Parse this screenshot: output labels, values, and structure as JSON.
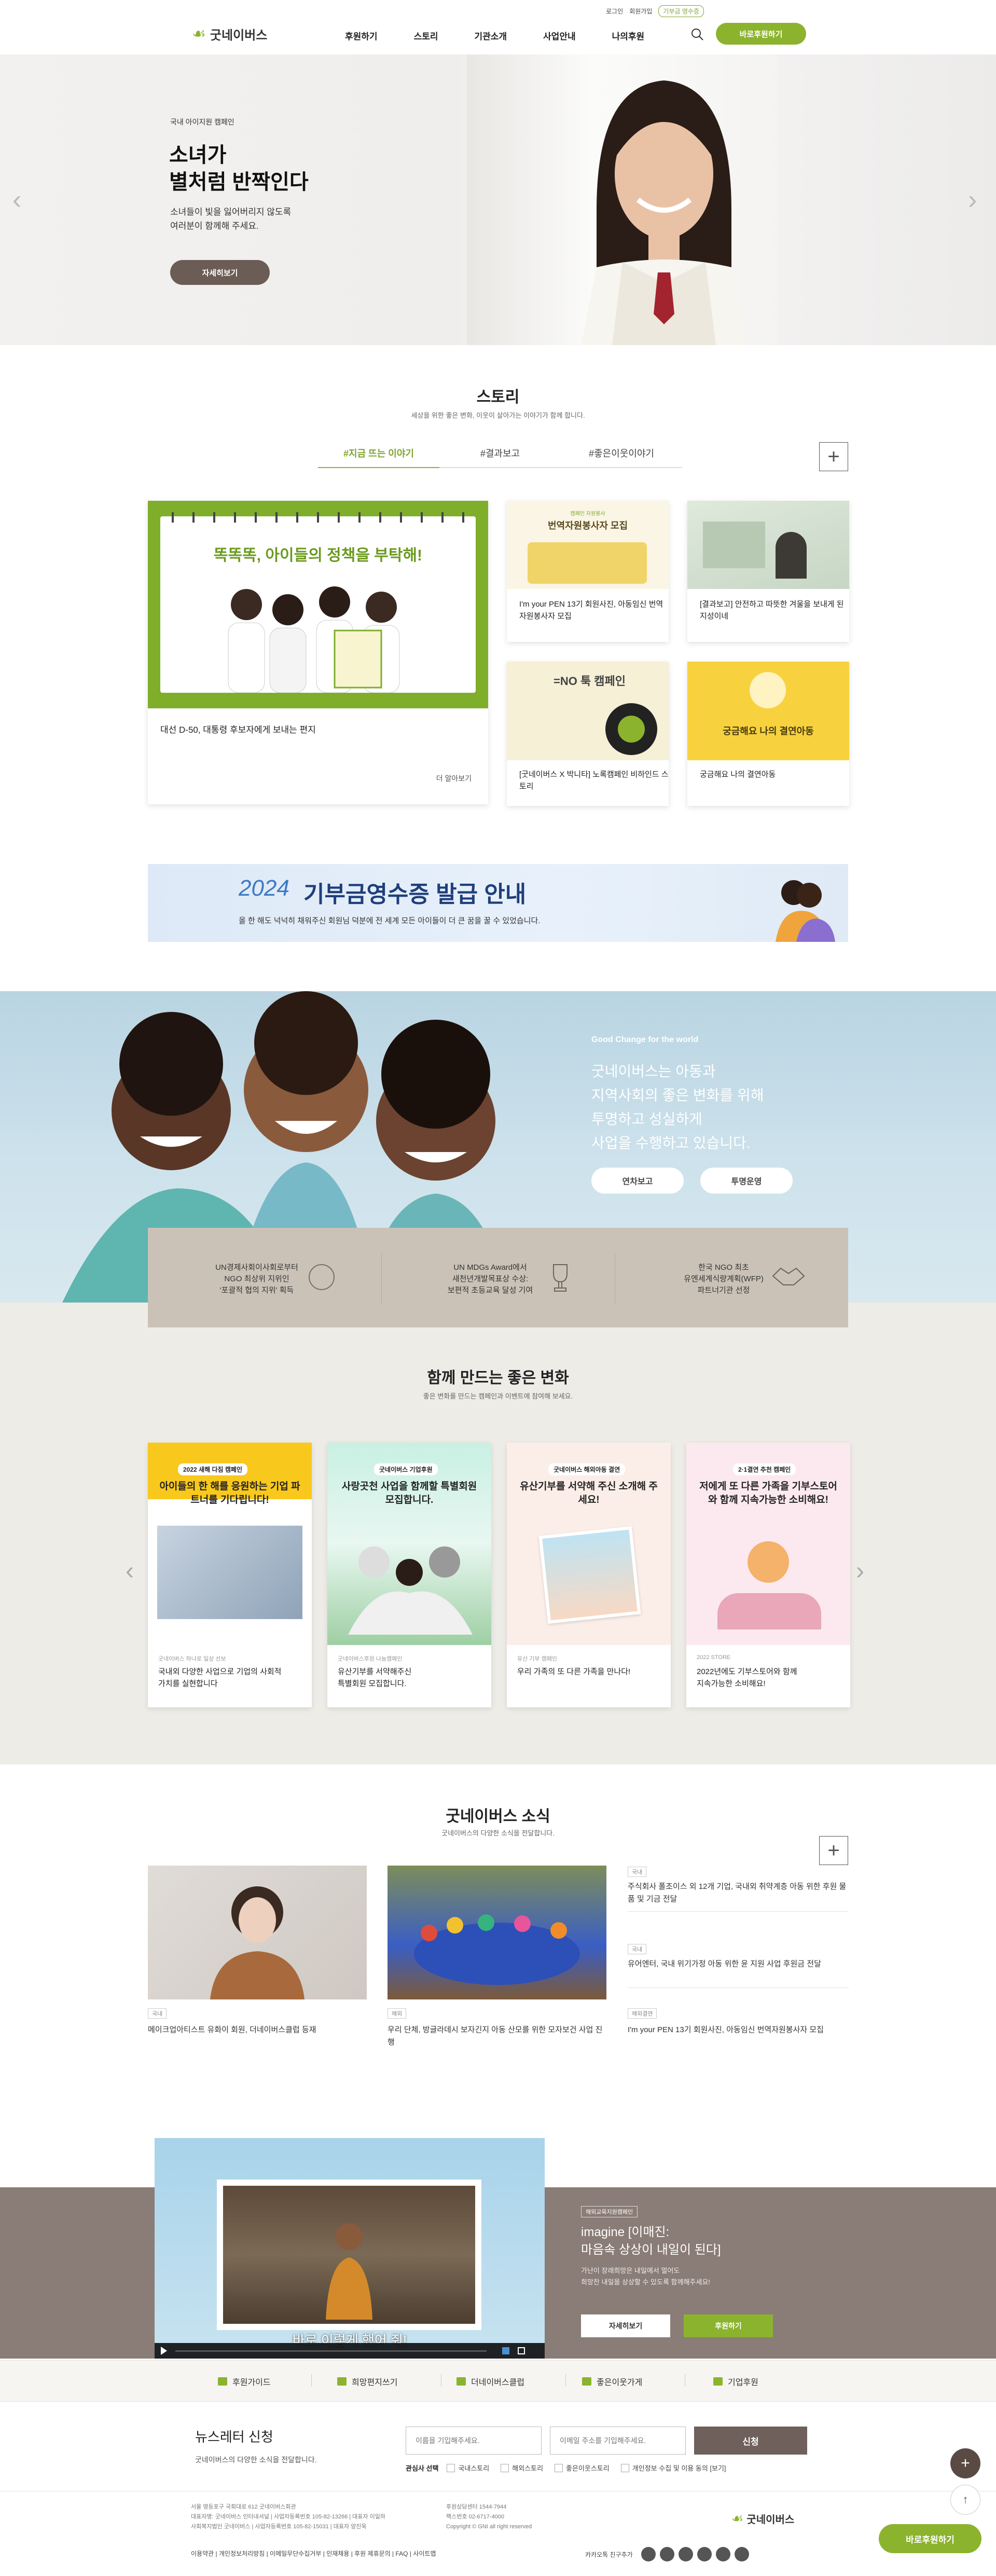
{
  "util": {
    "login": "로그인",
    "join": "회원가입",
    "pill": "기부금 영수증"
  },
  "header": {
    "logo": "굿네이버스",
    "nav": [
      "후원하기",
      "스토리",
      "기관소개",
      "사업안내",
      "나의후원"
    ],
    "donate": "바로후원하기"
  },
  "hero": {
    "sub": "국내 아이지원 캠페인",
    "title1": "소녀가",
    "title2": "별처럼 반짝인다",
    "desc1": "소녀들이 빛을 잃어버리지 않도록",
    "desc2": "여러분이 함께해 주세요.",
    "btn": "자세히보기"
  },
  "story": {
    "title": "스토리",
    "sub": "세상을 위한 좋은 변화, 이웃이 살아가는 이야기가 함께 합니다.",
    "tabs": [
      "#지금 뜨는 이야기",
      "#결과보고",
      "#좋은이웃이야기"
    ],
    "main_card": {
      "headline": "똑똑똑, 아이들의 정책을 부탁해!",
      "caption": "대선 D-50, 대통령 후보자에게 보내는 편지",
      "more": "더 알아보기"
    },
    "cards": [
      {
        "img_title": "번역자원봉사자 모집",
        "img_badge": "캠페인 자원봉사",
        "caption": "I'm your PEN 13기 회원사진, 아동임신 번역자원봉사자 모집"
      },
      {
        "caption": "[결과보고] 안전하고 따뜻한 겨울을 보내게 된 지성이네"
      },
      {
        "img_title": "=NO 툭 캠페인",
        "caption": "[굿네이버스 X 박니타] 노록캠페인 비하인드 스토리"
      },
      {
        "img_title": "궁금해요 나의 결연아동",
        "caption": "궁금해요 나의 결연아동"
      }
    ]
  },
  "receipt": {
    "year": "2024",
    "title": "기부금영수증 발급 안내",
    "sub": "올 한 해도 넉넉히 채워주신 회원님 덕분에 전 세계 모든 아이들이 더 큰 꿈을 꿀 수 있었습니다."
  },
  "good_change": {
    "small": "Good Change for the world",
    "line1": "굿네이버스는 아동과",
    "line2": "지역사회의 좋은 변화를 위해",
    "line3": "투명하고 성실하게",
    "line4": "사업을 수행하고 있습니다.",
    "btn1": "연차보고",
    "btn2": "투명운영",
    "awards": [
      {
        "l1": "UN경제사회이사회로부터",
        "l2": "NGO 최상위 지위인",
        "l3": "'포괄적 협의 지위' 획득"
      },
      {
        "l1": "UN MDGs Award에서",
        "l2": "새천년개발목표상 수상:",
        "l3": "보편적 초등교육 달성 기여"
      },
      {
        "l1": "한국 NGO 최초",
        "l2": "유엔세계식량계획(WFP)",
        "l3": "파트너기관 선정"
      }
    ]
  },
  "together": {
    "title": "함께 만드는 좋은 변화",
    "sub": "좋은 변화를 만드는 캠페인과 이벤트에 참여해 보세요.",
    "cards": [
      {
        "badge": "2022 새해 다짐 캠페인",
        "head": "아이들의 한 해를 응원하는 기업 파트너를 기다립니다!",
        "small": "굿네이버스 하나로 일상 선보",
        "cap1": "국내외 다양한 사업으로 기업의 사회적",
        "cap2": "가치를 실현합니다"
      },
      {
        "badge": "굿네이버스 기업후원",
        "head": "사랑곳천 사업을 함께할 특별회원 모집합니다.",
        "small": "굿네이버스후원 나눔캠페인",
        "cap1": "유산기부를 서약해주신",
        "cap2": "특별회원 모집합니다."
      },
      {
        "badge": "굿네이버스 해외아동 결연",
        "head": "유산기부를 서약해 주신 소개해 주세요!",
        "small": "유산 기부 캠페인",
        "cap1": "우리 가족의 또 다른 가족을 만나다!",
        "cap2": ""
      },
      {
        "badge": "2·1결연 추천 캠페인",
        "head": "저에게 또 다른 가족을 기부스토어와 함께 지속가능한 소비해요!",
        "small": "2022 STORE",
        "cap1": "2022년에도 기부스토어와 함께",
        "cap2": "지속가능한 소비해요!"
      }
    ]
  },
  "news": {
    "title": "굿네이버스 소식",
    "sub": "굿네이버스의 다양한 소식을 전달합니다.",
    "items": [
      {
        "tag": "국내",
        "text": "메이크업아티스트 유화이 회원, 더네이버스클럽 등재"
      },
      {
        "tag": "해외",
        "text": "우리 단체, 방글라데시 보자긴지 아동 산모를 위한 모자보건 사업 진행"
      },
      {
        "tag": "국내",
        "text": "주식회사 폴조이스 외 12개 기업, 국내외 취약계층 아동 위한 후원 물품 및 기금 전달"
      },
      {
        "tag": "국내",
        "text": "유어엔터, 국내 위기가정 아동 위한 윤 지원 사업 후원금 전달"
      },
      {
        "tag": "해외결연",
        "text": "I'm your PEN 13기 회원사진, 아동임신 번역자원봉사자 모집"
      }
    ]
  },
  "video": {
    "badge": "해외교육지원캠페인",
    "title1": "imagine [이매진:",
    "title2": "마음속 상상이 내일이 된다]",
    "desc1": "가난이 장래희망은 내일에서 멀어도",
    "desc2": "희망찬 내일을 상상할 수 있도록 함께해주세요!",
    "btn1": "자세히보기",
    "btn2": "후원하기",
    "subtitle": "바로 이렇게 했어 줘!"
  },
  "footer_nav": [
    "후원가이드",
    "희망편지쓰기",
    "더네이버스클럽",
    "좋은이웃가게",
    "기업후원"
  ],
  "newsletter": {
    "title": "뉴스레터 신청",
    "sub": "굿네이버스의 다양한 소식을 전달합니다.",
    "name_ph": "이름을 기입해주세요.",
    "email_ph": "이메일 주소를 기입해주세요.",
    "btn": "신청",
    "interest_label": "관심사 선택",
    "options": [
      "국내스토리",
      "해외스토리",
      "좋은이웃스토리",
      "개인정보 수집 및 이용 동의 [보기]"
    ]
  },
  "footer": {
    "addr1": "서울 영등포구 국회대로 612 굿네이버스회관",
    "addr2": "대표자명: 굿네이버스 인터내셔널 | 사업자등록번호 105-82-13266 | 대표자 이일하",
    "addr3": "사회복지법인 굿네이버스 | 사업자등록번호 105-82-15031 | 대표자 양진옥",
    "call1": "후원상담센터 1544-7944",
    "call2": "팩스번호 02-6717-4000",
    "copyright": "Copyright © GNI all right reserved",
    "links": "이용약관 | 개인정보처리방침 | 이메일무단수집거부 | 인재채용 | 후원 제휴문의 | FAQ | 사이트맵",
    "kakao": "카카오톡 친구추가",
    "logo": "굿네이버스",
    "float_btn": "바로후원하기"
  },
  "colors": {
    "green": "#8cb32e",
    "brown": "#6b5c55",
    "beige": "#cac2b7"
  }
}
